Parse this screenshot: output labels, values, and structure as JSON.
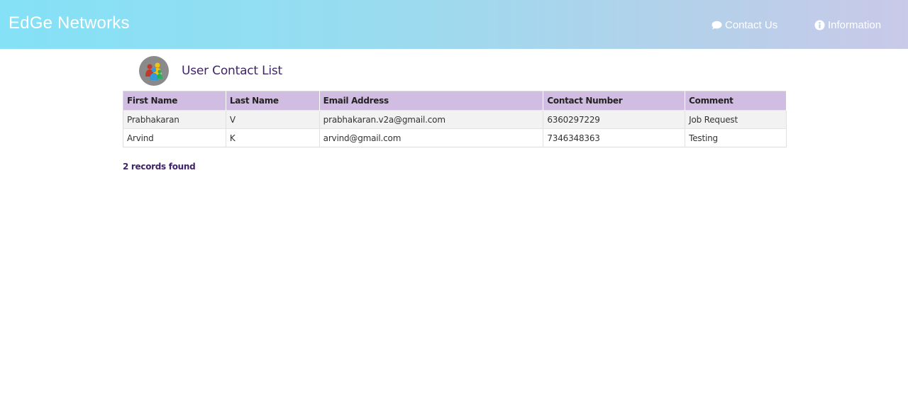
{
  "header": {
    "brand": "EdGe Networks",
    "nav": [
      {
        "label": "Contact Us",
        "icon": "comment-icon"
      },
      {
        "label": "Information",
        "icon": "info-circle-icon"
      }
    ]
  },
  "page": {
    "title": "User Contact List",
    "avatar_icon": "users-group-icon"
  },
  "table": {
    "columns": [
      "First Name",
      "Last Name",
      "Email Address",
      "Contact Number",
      "Comment"
    ],
    "rows": [
      [
        "Prabhakaran",
        "V",
        "prabhakaran.v2a@gmail.com",
        "6360297229",
        "Job Request"
      ],
      [
        "Arvind",
        "K",
        "arvind@gmail.com",
        "7346348363",
        "Testing"
      ]
    ]
  },
  "footer": {
    "record_count": "2 records found"
  },
  "colors": {
    "header_gradient_start": "#84e1f6",
    "header_gradient_end": "#c9c9e8",
    "table_header_bg": "#d1bde1",
    "title_color": "#3f2468"
  }
}
